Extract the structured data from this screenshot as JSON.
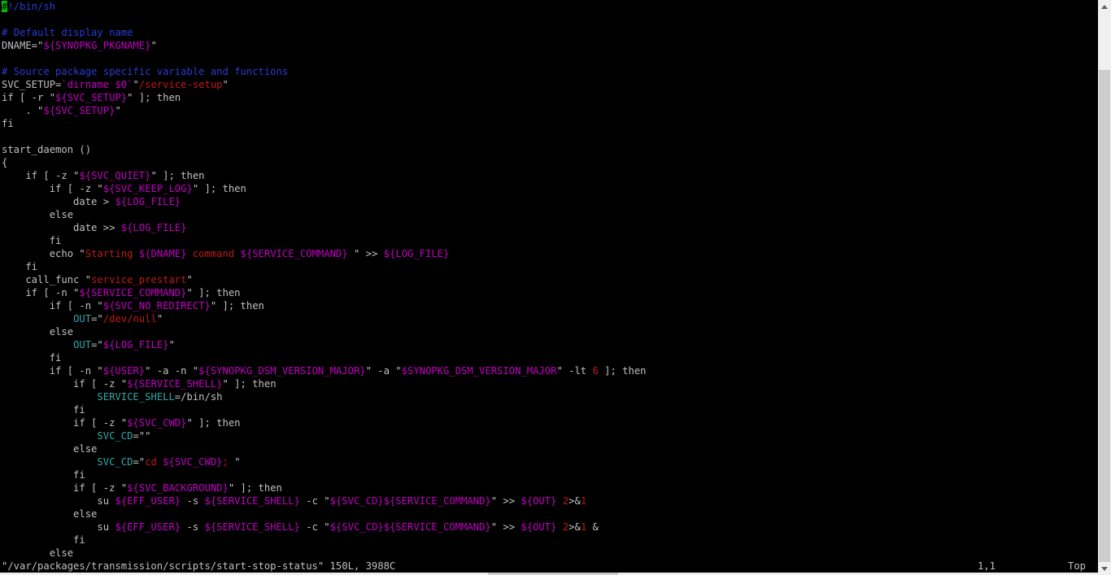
{
  "editor": {
    "lines": [
      [
        [
          "#",
          "cursor"
        ],
        [
          "!/bin/sh",
          "c"
        ]
      ],
      [],
      [
        [
          "# Default display name",
          "c"
        ]
      ],
      [
        [
          "DNAME=",
          ""
        ],
        [
          "\"",
          ""
        ],
        [
          "${SYNOPKG_PKGNAME}",
          "v"
        ],
        [
          "\"",
          ""
        ]
      ],
      [],
      [
        [
          "# Source package specific variable and functions",
          "c"
        ]
      ],
      [
        [
          "SVC_SETUP=",
          ""
        ],
        [
          "`dirname $0`",
          "v"
        ],
        [
          "\"",
          ""
        ],
        [
          "/service-setup",
          "s"
        ],
        [
          "\"",
          ""
        ]
      ],
      [
        [
          "if [ -r \"",
          ""
        ],
        [
          "${SVC_SETUP}",
          "v"
        ],
        [
          "\" ]; then",
          ""
        ]
      ],
      [
        [
          "    . \"",
          ""
        ],
        [
          "${SVC_SETUP}",
          "v"
        ],
        [
          "\"",
          ""
        ]
      ],
      [
        [
          "fi",
          ""
        ]
      ],
      [],
      [
        [
          "start_daemon ()",
          ""
        ]
      ],
      [
        [
          "{",
          ""
        ]
      ],
      [
        [
          "    if [ -z \"",
          ""
        ],
        [
          "${SVC_QUIET}",
          "v"
        ],
        [
          "\" ]; then",
          ""
        ]
      ],
      [
        [
          "        if [ -z \"",
          ""
        ],
        [
          "${SVC_KEEP_LOG}",
          "v"
        ],
        [
          "\" ]; then",
          ""
        ]
      ],
      [
        [
          "            date > ",
          ""
        ],
        [
          "${LOG_FILE}",
          "v"
        ]
      ],
      [
        [
          "        else",
          ""
        ]
      ],
      [
        [
          "            date >> ",
          ""
        ],
        [
          "${LOG_FILE}",
          "v"
        ]
      ],
      [
        [
          "        fi",
          ""
        ]
      ],
      [
        [
          "        echo \"",
          ""
        ],
        [
          "Starting ",
          "s"
        ],
        [
          "${DNAME}",
          "v"
        ],
        [
          " command ",
          "s"
        ],
        [
          "${SERVICE_COMMAND}",
          "v"
        ],
        [
          " \" >> ",
          ""
        ],
        [
          "${LOG_FILE}",
          "v"
        ]
      ],
      [
        [
          "    fi",
          ""
        ]
      ],
      [
        [
          "    call_func \"",
          ""
        ],
        [
          "service_prestart",
          "s"
        ],
        [
          "\"",
          ""
        ]
      ],
      [
        [
          "    if [ -n \"",
          ""
        ],
        [
          "${SERVICE_COMMAND}",
          "v"
        ],
        [
          "\" ]; then",
          ""
        ]
      ],
      [
        [
          "        if [ -n \"",
          ""
        ],
        [
          "${SVC_NO_REDIRECT}",
          "v"
        ],
        [
          "\" ]; then",
          ""
        ]
      ],
      [
        [
          "            ",
          ""
        ],
        [
          "OUT",
          "i"
        ],
        [
          "=\"",
          ""
        ],
        [
          "/dev/null",
          "s"
        ],
        [
          "\"",
          ""
        ]
      ],
      [
        [
          "        else",
          ""
        ]
      ],
      [
        [
          "            ",
          ""
        ],
        [
          "OUT",
          "i"
        ],
        [
          "=\"",
          ""
        ],
        [
          "${LOG_FILE}",
          "v"
        ],
        [
          "\"",
          ""
        ]
      ],
      [
        [
          "        fi",
          ""
        ]
      ],
      [
        [
          "        if [ -n \"",
          ""
        ],
        [
          "${USER}",
          "v"
        ],
        [
          "\" -a -n \"",
          ""
        ],
        [
          "${SYNOPKG_DSM_VERSION_MAJOR}",
          "v"
        ],
        [
          "\" -a \"",
          ""
        ],
        [
          "$SYNOPKG_DSM_VERSION_MAJOR",
          "v"
        ],
        [
          "\" -lt ",
          ""
        ],
        [
          "6",
          "n"
        ],
        [
          " ]; then",
          ""
        ]
      ],
      [
        [
          "            if [ -z \"",
          ""
        ],
        [
          "${SERVICE_SHELL}",
          "v"
        ],
        [
          "\" ]; then",
          ""
        ]
      ],
      [
        [
          "                ",
          ""
        ],
        [
          "SERVICE_SHELL",
          "i"
        ],
        [
          "=/bin/sh",
          ""
        ]
      ],
      [
        [
          "            fi",
          ""
        ]
      ],
      [
        [
          "            if [ -z \"",
          ""
        ],
        [
          "${SVC_CWD}",
          "v"
        ],
        [
          "\" ]; then",
          ""
        ]
      ],
      [
        [
          "                ",
          ""
        ],
        [
          "SVC_CD",
          "i"
        ],
        [
          "=\"\"",
          ""
        ]
      ],
      [
        [
          "            else",
          ""
        ]
      ],
      [
        [
          "                ",
          ""
        ],
        [
          "SVC_CD",
          "i"
        ],
        [
          "=\"",
          ""
        ],
        [
          "cd ",
          "s"
        ],
        [
          "${SVC_CWD}",
          "v"
        ],
        [
          "; ",
          "s"
        ],
        [
          "\"",
          ""
        ]
      ],
      [
        [
          "            fi",
          ""
        ]
      ],
      [
        [
          "            if [ -z \"",
          ""
        ],
        [
          "${SVC_BACKGROUND}",
          "v"
        ],
        [
          "\" ]; then",
          ""
        ]
      ],
      [
        [
          "                su ",
          ""
        ],
        [
          "${EFF_USER}",
          "v"
        ],
        [
          " -s ",
          ""
        ],
        [
          "${SERVICE_SHELL}",
          "v"
        ],
        [
          " -c \"",
          ""
        ],
        [
          "${SVC_CD}${SERVICE_COMMAND}",
          "v"
        ],
        [
          "\" >> ",
          ""
        ],
        [
          "${OUT}",
          "v"
        ],
        [
          " ",
          ""
        ],
        [
          "2",
          "n"
        ],
        [
          ">&",
          ""
        ],
        [
          "1",
          "n"
        ]
      ],
      [
        [
          "            else",
          ""
        ]
      ],
      [
        [
          "                su ",
          ""
        ],
        [
          "${EFF_USER}",
          "v"
        ],
        [
          " -s ",
          ""
        ],
        [
          "${SERVICE_SHELL}",
          "v"
        ],
        [
          " -c \"",
          ""
        ],
        [
          "${SVC_CD}${SERVICE_COMMAND}",
          "v"
        ],
        [
          "\" >> ",
          ""
        ],
        [
          "${OUT}",
          "v"
        ],
        [
          " ",
          ""
        ],
        [
          "2",
          "n"
        ],
        [
          ">&",
          ""
        ],
        [
          "1",
          "n"
        ],
        [
          " &",
          ""
        ]
      ],
      [
        [
          "            fi",
          ""
        ]
      ],
      [
        [
          "        else",
          ""
        ]
      ]
    ]
  },
  "status": {
    "file_info": "\"/var/packages/transmission/scripts/start-stop-status\" 150L, 3988C",
    "position": "1,1",
    "scroll": "Top"
  },
  "colors": {
    "comment": "#2b3bd6",
    "string": "#c01818",
    "variable": "#c000c0",
    "identifier": "#2fa8a8",
    "cursor": "#00c000",
    "text": "#c0c0c0",
    "background": "#000000"
  }
}
